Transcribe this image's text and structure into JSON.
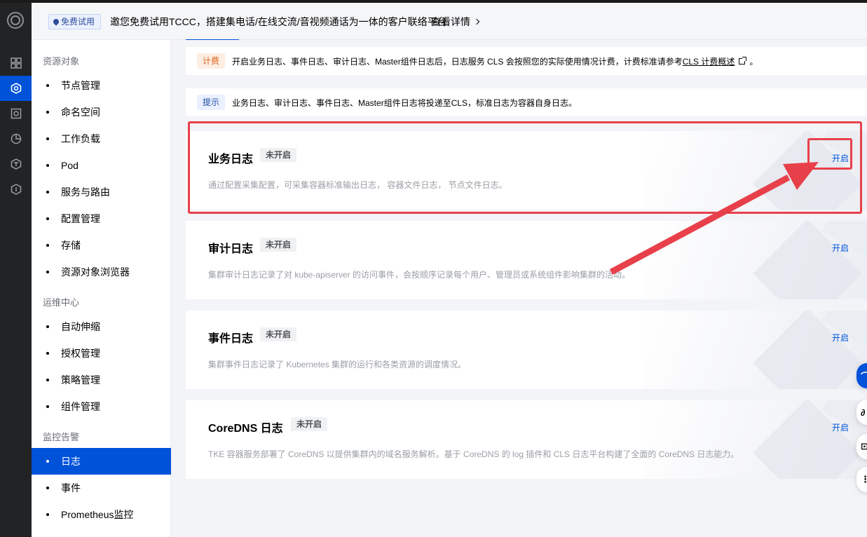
{
  "banner": {
    "badge": "免费试用",
    "text": "邀您免费试用TCCC，搭建集电话/在线交流/音视频通话为一体的客户联络平台",
    "link": "查看详情"
  },
  "rail": {
    "items": [
      {
        "icon": "grid-icon"
      },
      {
        "icon": "container-icon",
        "active": true
      },
      {
        "icon": "square-target-icon"
      },
      {
        "icon": "pie-chart-icon"
      },
      {
        "icon": "cube-icon"
      },
      {
        "icon": "hexagon-info-icon"
      }
    ]
  },
  "sidebar": {
    "groups": [
      {
        "title": "资源对象",
        "items": [
          "节点管理",
          "命名空间",
          "工作负载",
          "Pod",
          "服务与路由",
          "配置管理",
          "存储",
          "资源对象浏览器"
        ]
      },
      {
        "title": "运维中心",
        "items": [
          "自动伸缩",
          "授权管理",
          "策略管理",
          "组件管理"
        ]
      },
      {
        "title": "监控告警",
        "items": [
          "日志",
          "事件",
          "Prometheus监控"
        ]
      }
    ],
    "active_item": "日志"
  },
  "notices": {
    "billing": {
      "tag": "计费",
      "text": "开启业务日志、事件日志、审计日志、Master组件日志后，日志服务 CLS 会按照您的实际使用情况计费，计费标准请参考",
      "link": "CLS 计费概述",
      "suffix": "。"
    },
    "tip": {
      "tag": "提示",
      "text": "业务日志、审计日志、事件日志、Master组件日志将投递至CLS，标准日志为容器自身日志。"
    }
  },
  "cards": [
    {
      "title": "业务日志",
      "status": "未开启",
      "desc": "通过配置采集配置，可采集容器标准输出日志， 容器文件日志， 节点文件日志。",
      "action": "开启"
    },
    {
      "title": "审计日志",
      "status": "未开启",
      "desc": "集群审计日志记录了对 kube-apiserver 的访问事件，会按顺序记录每个用户、管理员或系统组件影响集群的活动。",
      "action": "开启"
    },
    {
      "title": "事件日志",
      "status": "未开启",
      "desc": "集群事件日志记录了 Kubernetes 集群的运行和各类资源的调度情况。",
      "action": "开启"
    },
    {
      "title": "CoreDNS 日志",
      "status": "未开启",
      "desc": "TKE 容器服务部署了 CoreDNS 以提供集群内的域名服务解析。基于 CoreDNS 的 log 插件和 CLS 日志平台构建了全面的 CoreDNS 日志能力。",
      "action": "开启"
    }
  ],
  "colors": {
    "accent": "#0052d9",
    "highlight": "#e8404a",
    "billing_tag": "#d9641c"
  }
}
